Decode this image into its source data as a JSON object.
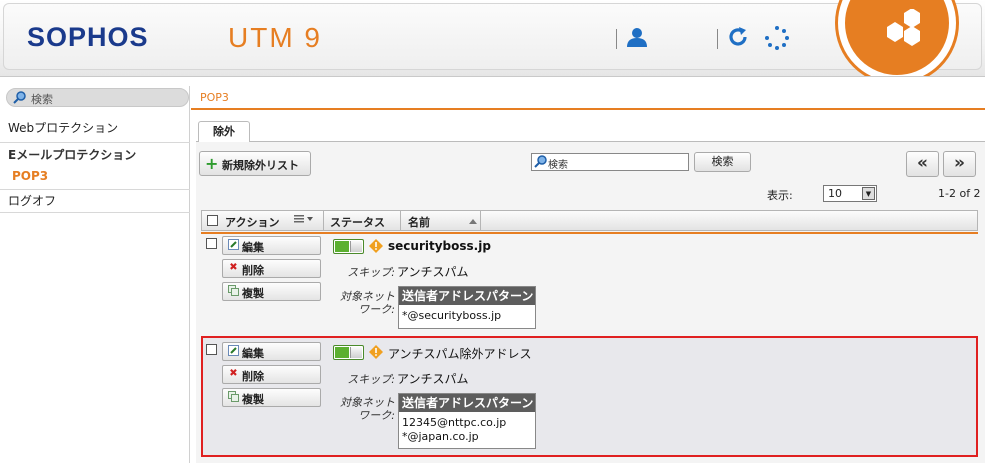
{
  "header": {
    "brand": "SOPHOS",
    "product": "UTM 9",
    "user_icon": "user-icon",
    "refresh_icon": "refresh-icon",
    "spinner_icon": "spinner-icon"
  },
  "sidebar": {
    "search_placeholder": "検索",
    "items": [
      {
        "label": "Webプロテクション"
      },
      {
        "label": "Eメールプロテクション"
      },
      {
        "label": "POP3"
      },
      {
        "label": "ログオフ"
      }
    ]
  },
  "main": {
    "breadcrumb": "POP3",
    "tab": "除外",
    "new_button": "新規除外リスト",
    "search_value": "検索",
    "search_button": "検索",
    "prev_label": "«",
    "next_label": "»",
    "show_label": "表示:",
    "per_page": "10",
    "range": "1-2 of 2",
    "columns": {
      "action": "アクション",
      "status": "ステータス",
      "name": "名前"
    },
    "actions": {
      "edit": "編集",
      "delete": "削除",
      "clone": "複製"
    },
    "labels": {
      "skip": "スキップ:",
      "target_line1": "対象ネット",
      "target_line2": "ワーク:",
      "pattern_header": "送信者アドレスパターン"
    },
    "rows": [
      {
        "name": "securityboss.jp",
        "skip": "アンチスパム",
        "patterns": [
          "*@securityboss.jp"
        ]
      },
      {
        "name": "アンチスパム除外アドレス",
        "skip": "アンチスパム",
        "patterns": [
          "12345@nttpc.co.jp",
          "*@japan.co.jp"
        ]
      }
    ]
  },
  "colors": {
    "accent": "#e67e22",
    "brand": "#1a3a8c",
    "toggle_on": "#5cb030",
    "highlight": "#e02020"
  }
}
